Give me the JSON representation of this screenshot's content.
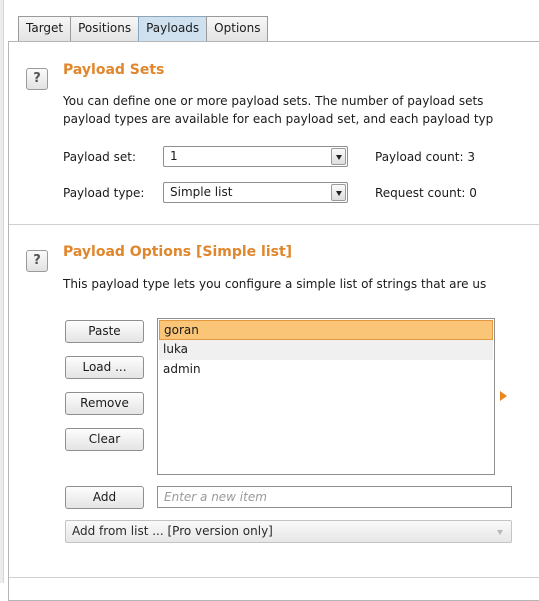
{
  "tabs": [
    "Target",
    "Positions",
    "Payloads",
    "Options"
  ],
  "active_tab": "Payloads",
  "payload_sets": {
    "help_glyph": "?",
    "title": "Payload Sets",
    "desc_line1": "You can define one or more payload sets. The number of payload sets",
    "desc_line2": "payload types are available for each payload set, and each payload typ",
    "set_label": "Payload set:",
    "set_value": "1",
    "count_label": "Payload count: 3",
    "type_label": "Payload type:",
    "type_value": "Simple list",
    "request_label": "Request count: 0"
  },
  "payload_options": {
    "help_glyph": "?",
    "title": "Payload Options [Simple list]",
    "desc": "This payload type lets you configure a simple list of strings that are us",
    "buttons": {
      "paste": "Paste",
      "load": "Load ...",
      "remove": "Remove",
      "clear": "Clear",
      "add": "Add"
    },
    "items": [
      "goran",
      "luka",
      "admin"
    ],
    "selected_index": 0,
    "add_placeholder": "Enter a new item",
    "add_from_list": "Add from list ... [Pro version only]"
  },
  "colors": {
    "accent": "#e0862c",
    "selection": "#fbc577"
  }
}
